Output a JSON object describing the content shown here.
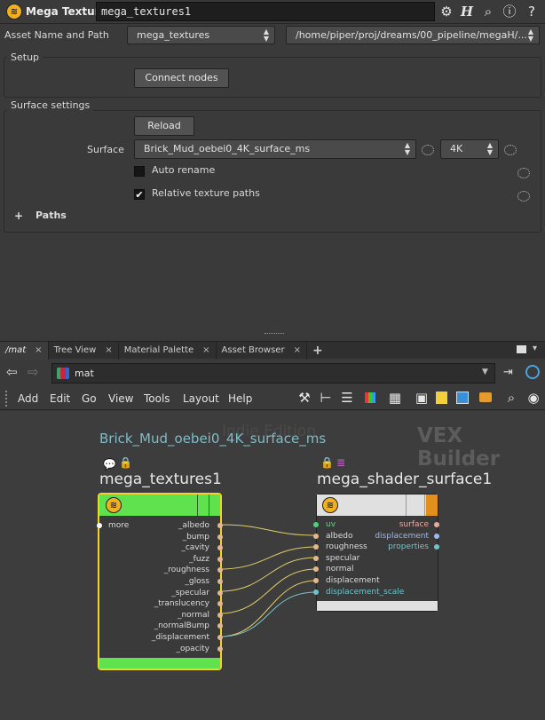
{
  "header": {
    "operator_type": "Mega Textures",
    "node_name": "mega_textures1"
  },
  "asset_row": {
    "label": "Asset Name and Path",
    "asset_name": "mega_textures",
    "asset_path": "/home/piper/proj/dreams/00_pipeline/megaH/..."
  },
  "setup": {
    "title": "Setup",
    "connect_button": "Connect nodes"
  },
  "surface_settings": {
    "title": "Surface settings",
    "reload_button": "Reload",
    "surface_label": "Surface",
    "surface_value": "Brick_Mud_oebei0_4K_surface_ms",
    "resolution_value": "4K",
    "auto_rename_label": "Auto rename",
    "auto_rename_checked": false,
    "relative_paths_label": "Relative texture paths",
    "relative_paths_checked": true,
    "paths_folder": "Paths"
  },
  "tabs": [
    {
      "label": "/mat",
      "active": true
    },
    {
      "label": "Tree View",
      "active": false
    },
    {
      "label": "Material Palette",
      "active": false
    },
    {
      "label": "Asset Browser",
      "active": false
    }
  ],
  "path": {
    "current": "mat"
  },
  "menu": [
    "Add",
    "Edit",
    "Go",
    "View",
    "Tools",
    "Layout",
    "Help"
  ],
  "network": {
    "watermark": "Indie Edition",
    "context_label": "VEX Builder",
    "network_box_title": "Brick_Mud_oebei0_4K_surface_ms",
    "source_node": {
      "name": "mega_textures1",
      "color": "#5fe24d",
      "input": "more",
      "outputs": [
        "_albedo",
        "_bump",
        "_cavity",
        "_fuzz",
        "_roughness",
        "_gloss",
        "_specular",
        "_translucency",
        "_normal",
        "_normalBump",
        "_displacement",
        "_opacity"
      ]
    },
    "shader_node": {
      "name": "mega_shader_surface1",
      "inputs": [
        "uv",
        "albedo",
        "roughness",
        "specular",
        "normal",
        "displacement",
        "displacement_scale"
      ],
      "outputs": [
        "surface",
        "displacement",
        "properties"
      ]
    }
  }
}
